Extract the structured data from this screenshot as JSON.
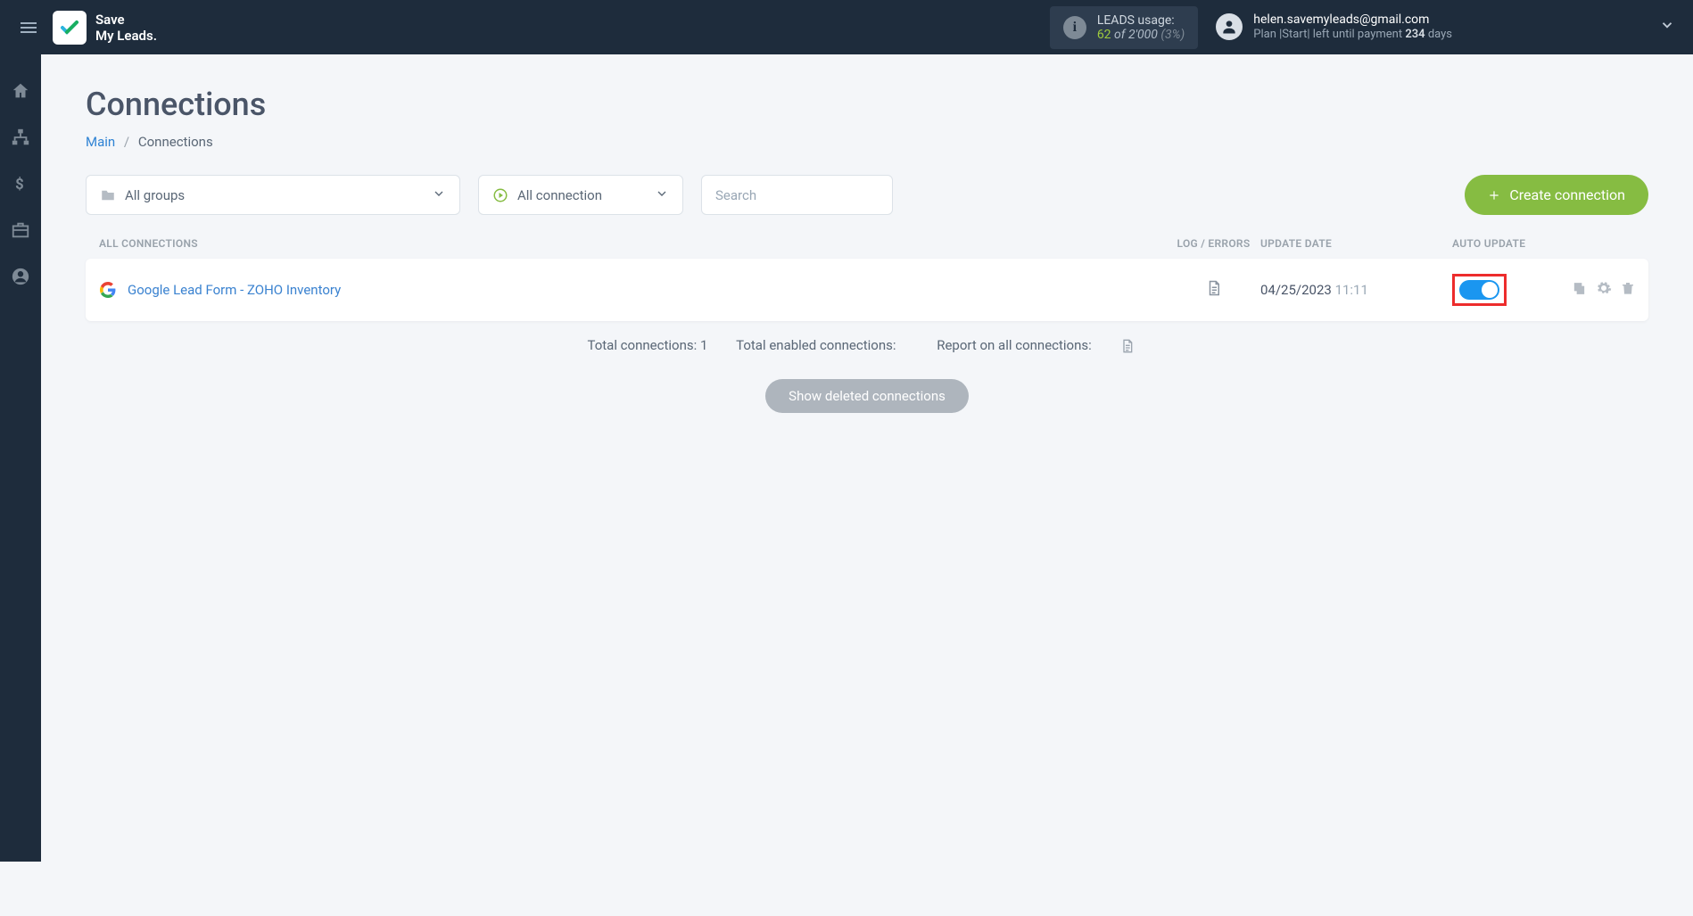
{
  "header": {
    "logo_line1": "Save",
    "logo_line2": "My Leads.",
    "leads_label": "LEADS usage:",
    "leads_current": "62",
    "leads_of": "of",
    "leads_max": "2'000",
    "leads_pct": "(3%)",
    "user_email": "helen.savemyleads@gmail.com",
    "plan_prefix": "Plan |",
    "plan_name": "Start",
    "plan_mid": "| left until payment",
    "plan_days": "234",
    "plan_suffix": "days"
  },
  "page": {
    "title": "Connections",
    "breadcrumb_main": "Main",
    "breadcrumb_current": "Connections"
  },
  "filters": {
    "groups_label": "All groups",
    "connection_label": "All connection",
    "search_placeholder": "Search",
    "create_label": "Create connection"
  },
  "table": {
    "head_name": "ALL CONNECTIONS",
    "head_log": "LOG / ERRORS",
    "head_date": "UPDATE DATE",
    "head_auto": "AUTO UPDATE"
  },
  "row": {
    "name": "Google Lead Form - ZOHO Inventory",
    "date": "04/25/2023",
    "time": "11:11"
  },
  "summary": {
    "total": "Total connections: 1",
    "enabled": "Total enabled connections:",
    "report": "Report on all connections:"
  },
  "show_deleted": "Show deleted connections"
}
